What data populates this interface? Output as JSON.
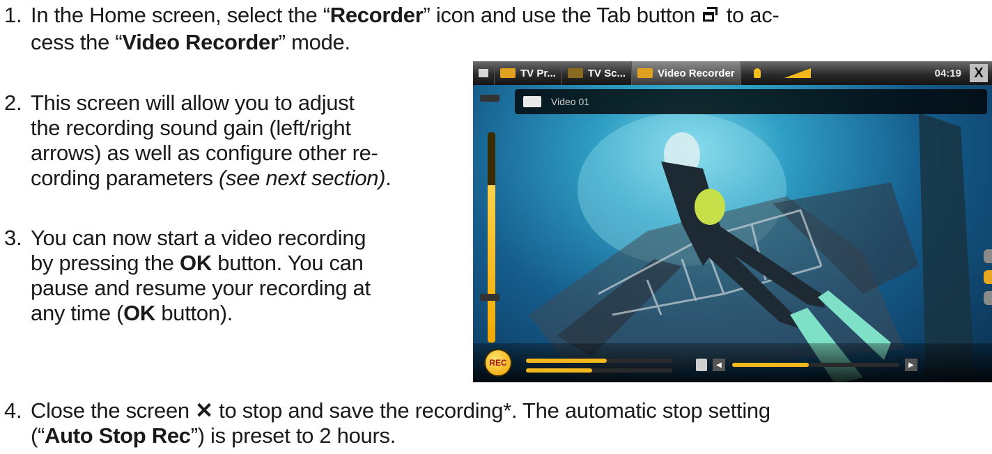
{
  "step1": {
    "num": "1.",
    "line1_pre": "In the Home screen, select the “",
    "recorder": "Recorder",
    "line1_mid": "” icon and use the Tab button ",
    "line1_post": " to ac-",
    "line2_pre": "cess the “",
    "video_recorder": "Video Recorder",
    "line2_post": "” mode."
  },
  "step2": {
    "num": "2.",
    "lines": [
      "This screen will allow you to adjust",
      "the recording sound gain (left/right",
      "arrows) as well as configure other re-"
    ],
    "line4_pre": "cording parameters ",
    "line4_italic": "(see next section)",
    "line4_post": "."
  },
  "step3": {
    "num": "3.",
    "line1": "You can now start a video recording",
    "line2_pre": "by pressing the ",
    "ok": "OK",
    "line2_post": " button. You can",
    "line3": "pause and resume your recording at",
    "line4_pre": "any time (",
    "line4_post": " button)."
  },
  "step4": {
    "num": "4.",
    "line1_pre": "Close the screen ",
    "line1_post": " to stop and save the recording*. The automatic stop setting",
    "line2_pre": "(“",
    "auto_stop": "Auto Stop Rec",
    "line2_post": "”) is preset to 2 hours."
  },
  "screenshot": {
    "tabs": [
      "TV Pr...",
      "TV Sc...",
      "Video Recorder"
    ],
    "time": "04:19",
    "close": "X",
    "filename": "Video 01",
    "rec": "REC",
    "vu_level": 0.75,
    "left_level": 0.55,
    "right_level": 0.45,
    "progress": 0.46
  },
  "colors": {
    "accent": "#f3b91c",
    "water": "#155c8c"
  },
  "icons": [
    "tab-button-icon",
    "close-x-icon"
  ]
}
